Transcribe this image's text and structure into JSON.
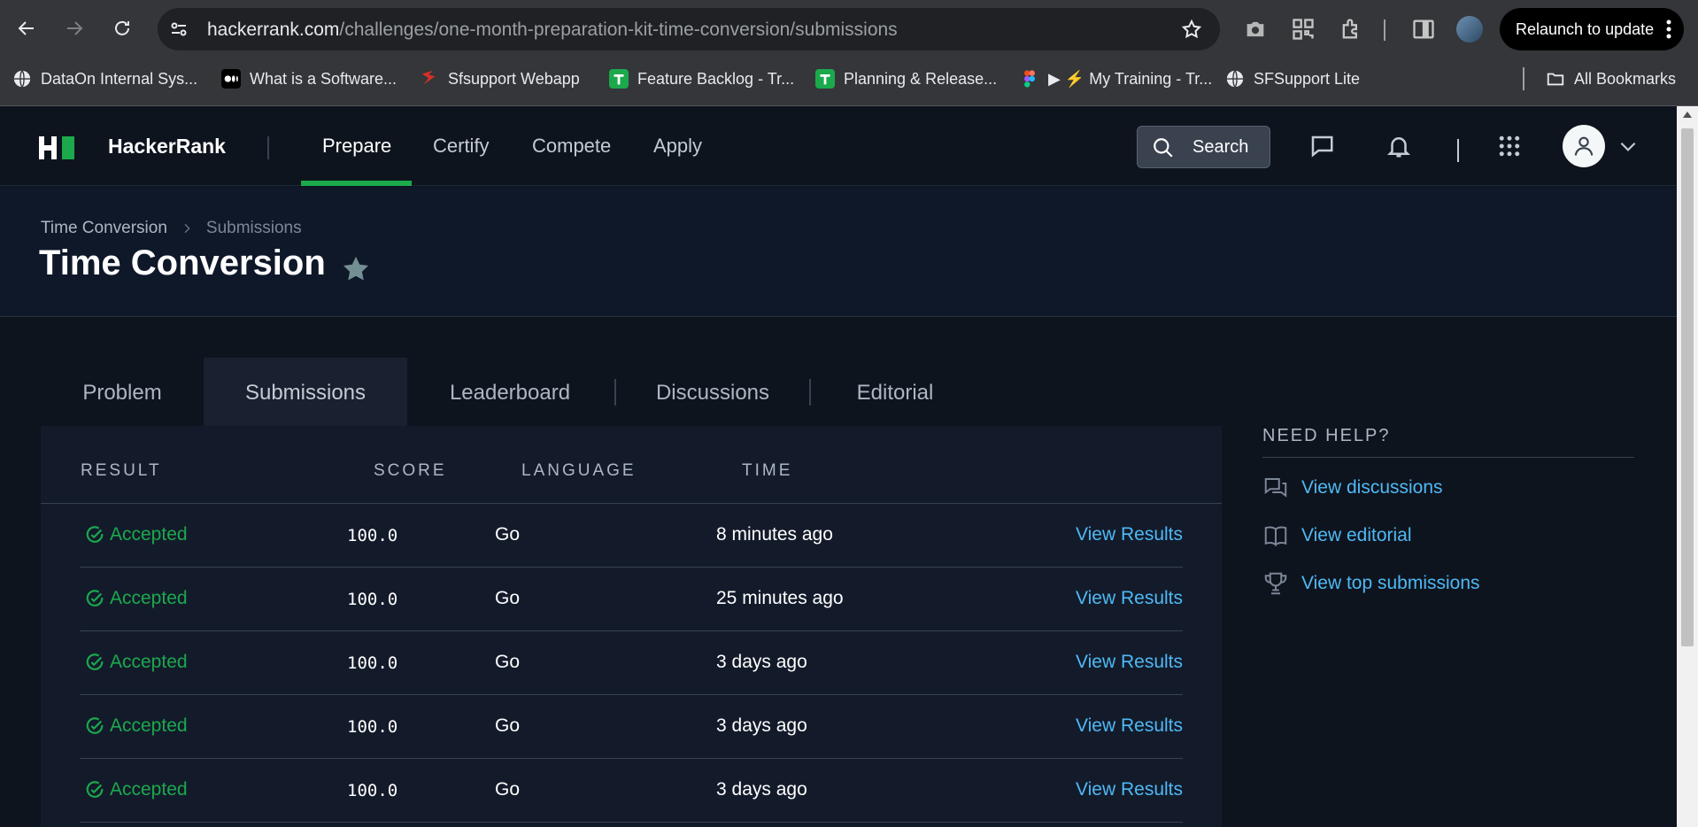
{
  "browser": {
    "url_host": "hackerrank.com",
    "url_path": "/challenges/one-month-preparation-kit-time-conversion/submissions",
    "relaunch_label": "Relaunch to update",
    "bookmarks": [
      {
        "label": "DataOn Internal Sys...",
        "color": "#1a73e8"
      },
      {
        "label": "What is a Software...",
        "color": "#000000"
      },
      {
        "label": "Sfsupport Webapp",
        "color": "#d93025"
      },
      {
        "label": "Feature Backlog - Tr...",
        "color": "#1ba94c"
      },
      {
        "label": "Planning & Release...",
        "color": "#1ba94c"
      },
      {
        "label": "▶ ⚡ My Training - Tr...",
        "color": "#f24e1e"
      },
      {
        "label": "SFSupport Lite",
        "color": "#e8eaed"
      }
    ],
    "all_bookmarks_label": "All Bookmarks"
  },
  "site": {
    "brand": "HackerRank",
    "nav": [
      "Prepare",
      "Certify",
      "Compete",
      "Apply"
    ],
    "search_label": "Search",
    "accent": "#1ba94c"
  },
  "header": {
    "breadcrumb": [
      "Time Conversion",
      "Submissions"
    ],
    "title": "Time Conversion"
  },
  "tabs": [
    "Problem",
    "Submissions",
    "Leaderboard",
    "Discussions",
    "Editorial"
  ],
  "table": {
    "headers": [
      "RESULT",
      "SCORE",
      "LANGUAGE",
      "TIME"
    ],
    "rows": [
      {
        "result": "Accepted",
        "score": "100.0",
        "language": "Go",
        "time": "8 minutes ago",
        "action": "View Results"
      },
      {
        "result": "Accepted",
        "score": "100.0",
        "language": "Go",
        "time": "25 minutes ago",
        "action": "View Results"
      },
      {
        "result": "Accepted",
        "score": "100.0",
        "language": "Go",
        "time": "3 days ago",
        "action": "View Results"
      },
      {
        "result": "Accepted",
        "score": "100.0",
        "language": "Go",
        "time": "3 days ago",
        "action": "View Results"
      },
      {
        "result": "Accepted",
        "score": "100.0",
        "language": "Go",
        "time": "3 days ago",
        "action": "View Results"
      }
    ]
  },
  "help": {
    "title": "NEED HELP?",
    "items": [
      {
        "label": "View discussions",
        "icon": "discussions-icon"
      },
      {
        "label": "View editorial",
        "icon": "book-icon"
      },
      {
        "label": "View top submissions",
        "icon": "trophy-icon"
      }
    ]
  }
}
